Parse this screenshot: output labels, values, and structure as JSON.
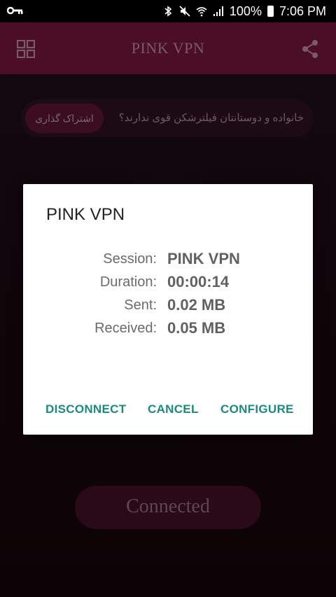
{
  "status_bar": {
    "battery": "100%",
    "time": "7:06 PM"
  },
  "app_bar": {
    "title": "PINK VPN",
    "left_icon": "grid-icon",
    "right_icon": "share-icon"
  },
  "background": {
    "banner_text": "خانواده و دوستانتان فیلترشکن قوی ندارند؟",
    "banner_button": "اشتراک گذاری",
    "connect_button": "Connected"
  },
  "dialog": {
    "title": "PINK VPN",
    "rows": [
      {
        "label": "Session:",
        "value": "PINK VPN"
      },
      {
        "label": "Duration:",
        "value": "00:00:14"
      },
      {
        "label": "Sent:",
        "value": "0.02 MB"
      },
      {
        "label": "Received:",
        "value": "0.05 MB"
      }
    ],
    "buttons": {
      "disconnect": "DISCONNECT",
      "cancel": "CANCEL",
      "configure": "CONFIGURE"
    }
  },
  "colors": {
    "app_bar": "#4b0e25",
    "accent_button": "#1b8a7e"
  }
}
